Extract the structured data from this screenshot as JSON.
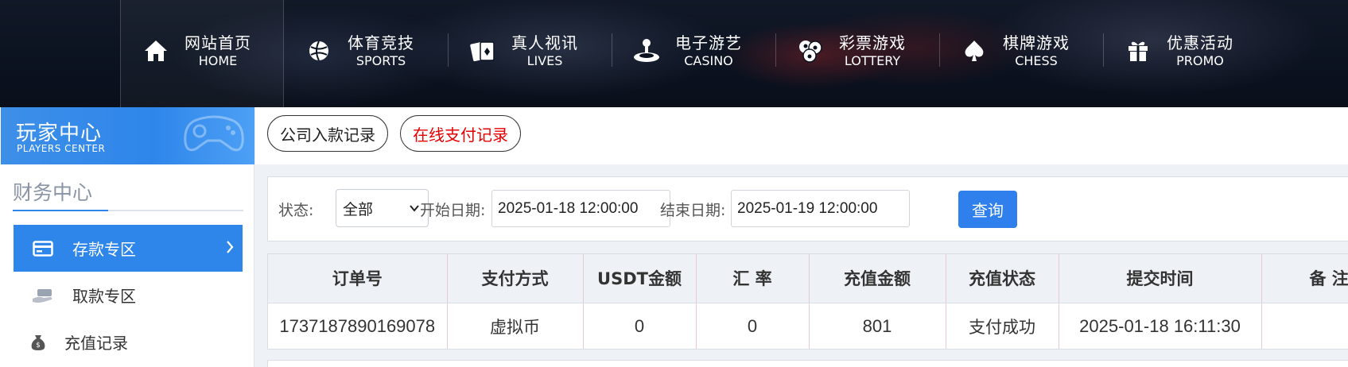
{
  "nav": {
    "items": [
      {
        "zh": "网站首页",
        "en": "HOME",
        "icon": "home-icon"
      },
      {
        "zh": "体育竞技",
        "en": "SPORTS",
        "icon": "basketball-icon"
      },
      {
        "zh": "真人视讯",
        "en": "LIVES",
        "icon": "cards-icon"
      },
      {
        "zh": "电子游艺",
        "en": "CASINO",
        "icon": "joystick-icon"
      },
      {
        "zh": "彩票游戏",
        "en": "LOTTERY",
        "icon": "lottery-balls-icon"
      },
      {
        "zh": "棋牌游戏",
        "en": "CHESS",
        "icon": "spade-icon"
      },
      {
        "zh": "优惠活动",
        "en": "PROMO",
        "icon": "gift-icon"
      }
    ]
  },
  "sidebar": {
    "banner_title": "玩家中心",
    "banner_subtitle": "PLAYERS CENTER",
    "section_title": "财务中心",
    "items": [
      {
        "label": "存款专区",
        "icon": "wallet-icon",
        "active": true
      },
      {
        "label": "取款专区",
        "icon": "hand-money-icon",
        "active": false
      },
      {
        "label": "充值记录",
        "icon": "money-bag-icon",
        "active": false
      }
    ]
  },
  "tabs": {
    "company_deposit": "公司入款记录",
    "online_payment": "在线支付记录"
  },
  "filter": {
    "status_label": "状态:",
    "status_value": "全部",
    "start_label": "开始日期:",
    "start_value": "2025-01-18 12:00:00",
    "end_label": "结束日期:",
    "end_value": "2025-01-19 12:00:00",
    "query_button": "查询"
  },
  "table": {
    "headers": [
      "订单号",
      "支付方式",
      "USDT金额",
      "汇 率",
      "充值金额",
      "充值状态",
      "提交时间",
      "备 注"
    ],
    "rows": [
      [
        "1737187890169078",
        "虚拟币",
        "0",
        "0",
        "801",
        "支付成功",
        "2025-01-18 16:11:30",
        ""
      ]
    ]
  },
  "colors": {
    "accent": "#2f86ea",
    "online_tab_text": "#e60000",
    "nav_bg": "#0b1220"
  }
}
